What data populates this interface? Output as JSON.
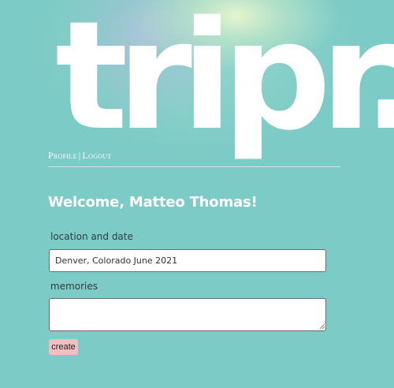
{
  "header": {
    "logo_text": "tripr."
  },
  "nav": {
    "profile_label": "Profile",
    "separator": "|",
    "logout_label": "Logout"
  },
  "main": {
    "welcome_text": "Welcome, Matteo Thomas!",
    "form": {
      "location_label": "location and date",
      "location_value": "Denver, Colorado June 2021",
      "memories_label": "memories",
      "memories_value": "",
      "submit_label": "create"
    }
  },
  "colors": {
    "background": "#7dcbc6",
    "text_light": "#ffffff",
    "button_bg": "#f2bfc1"
  }
}
